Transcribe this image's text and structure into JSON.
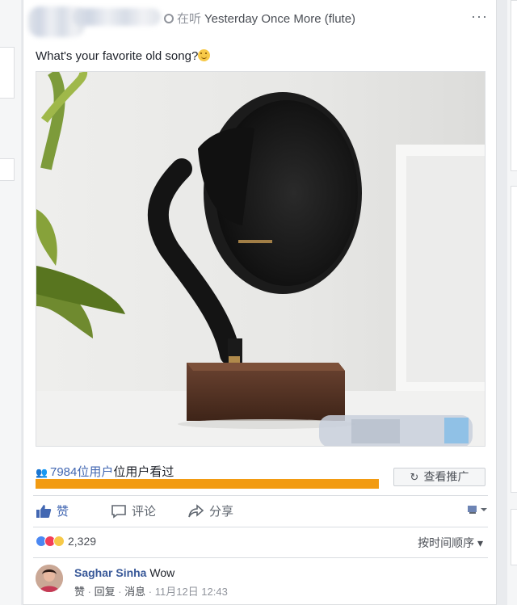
{
  "header": {
    "listening_label": "在听",
    "song": "Yesterday Once More (flute)",
    "more": "···"
  },
  "post": {
    "text": "What's your favorite old song?"
  },
  "stats": {
    "views_count": "7984位用户",
    "views_suffix": "位用户看过",
    "progress_fraction": 1.0,
    "promote_label": "查看推广"
  },
  "actions": {
    "like": "赞",
    "comment": "评论",
    "share": "分享"
  },
  "reactions": {
    "count": "2,329",
    "order_label": "按时间顺序"
  },
  "comment": {
    "author": "Saghar Sinha",
    "text": "Wow",
    "like": "赞",
    "reply": "回复",
    "message": "消息",
    "time": "11月12日 12:43"
  },
  "colors": {
    "link": "#4267b2",
    "progress": "#f29b12"
  }
}
